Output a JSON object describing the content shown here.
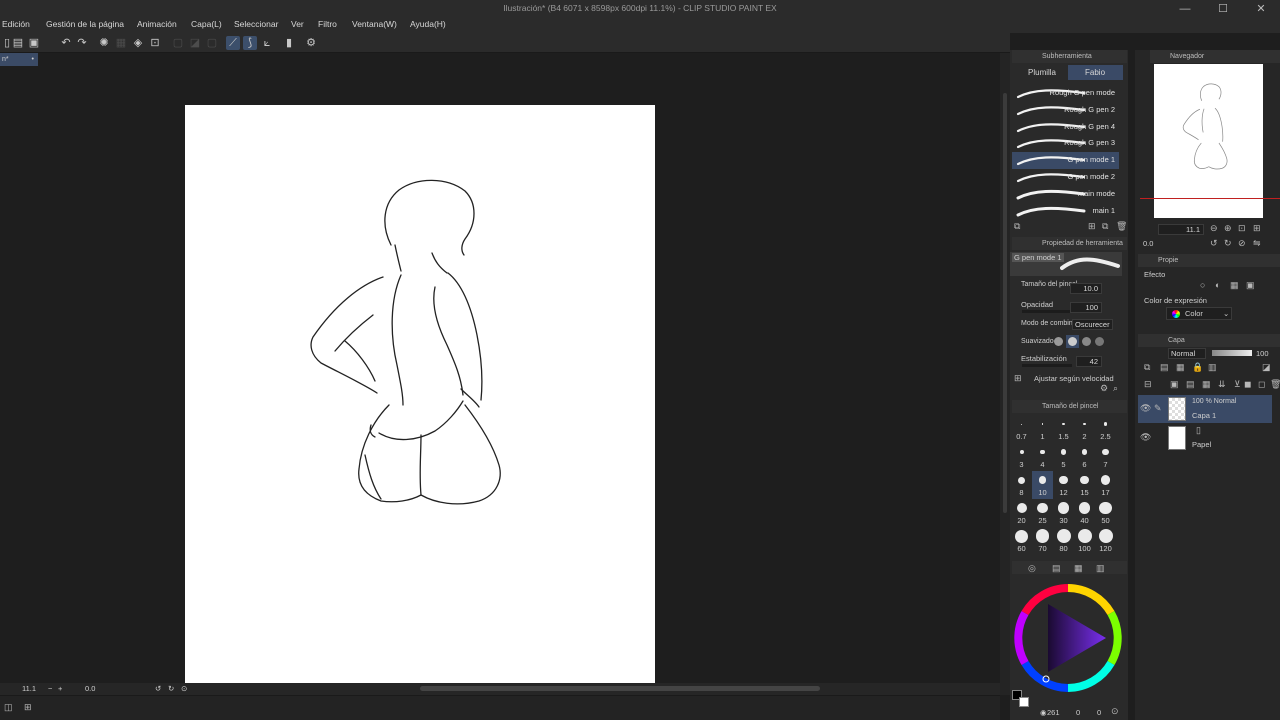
{
  "window": {
    "title": "Ilustración* (B4 6071 x 8598px 600dpi 11.1%) - CLIP STUDIO PAINT EX",
    "minimize": "—",
    "maximize": "☐",
    "close": "✕"
  },
  "menu": [
    "Edición",
    "Gestión de la página",
    "Animación",
    "Capa(L)",
    "Seleccionar",
    "Ver",
    "Filtro",
    "Ventana(W)",
    "Ayuda(H)"
  ],
  "doc_tab": "n*",
  "status": {
    "zoom": "11.1",
    "angle": "0.0"
  },
  "subtool_panel": {
    "title": "Subherramienta",
    "tabs": [
      "Plumilla",
      "Fabio"
    ],
    "brushes": [
      "Rough G pen mode",
      "Rough G pen 2",
      "Rough G pen 4",
      "Rough G pen 3",
      "G pen mode 1",
      "G pen mode 2",
      "main mode",
      "main 1"
    ],
    "selected_index": 4
  },
  "tool_property": {
    "title": "Propiedad de herramienta",
    "preset_name": "G pen mode 1",
    "brush_size_label": "Tamaño del pincel",
    "brush_size": "10.0",
    "opacity_label": "Opacidad",
    "opacity": "100",
    "blend_label": "Modo de combinar",
    "blend": "Oscurecer",
    "smoothing_label": "Suavizado",
    "stabilization_label": "Estabilización",
    "stabilization": "42",
    "speed_label": "Ajustar según velocidad"
  },
  "brush_size_panel": {
    "title": "Tamaño del pincel",
    "sizes": [
      "0.7",
      "1",
      "1.5",
      "2",
      "2.5",
      "3",
      "4",
      "5",
      "6",
      "7",
      "8",
      "10",
      "12",
      "15",
      "17",
      "20",
      "25",
      "30",
      "40",
      "50",
      "60",
      "70",
      "80",
      "100",
      "120"
    ],
    "selected": "10"
  },
  "color_panel": {
    "values": [
      "261",
      "0",
      "0"
    ],
    "colors": {
      "accent": "#3a4a66",
      "fg": "#000000",
      "bg": "#ffffff"
    }
  },
  "navigator": {
    "title": "Navegador",
    "zoom": "11.1",
    "angle": "0.0"
  },
  "layer_property": {
    "title": "Propie",
    "effect_label": "Efecto",
    "expression_label": "Color de expresión",
    "expression_value": "Color"
  },
  "layer_panel": {
    "title": "Capa",
    "blend": "Normal",
    "opacity": "100",
    "layers": [
      {
        "info": "100 % Normal",
        "name": "Capa 1"
      },
      {
        "info": "",
        "name": "Papel"
      }
    ]
  }
}
